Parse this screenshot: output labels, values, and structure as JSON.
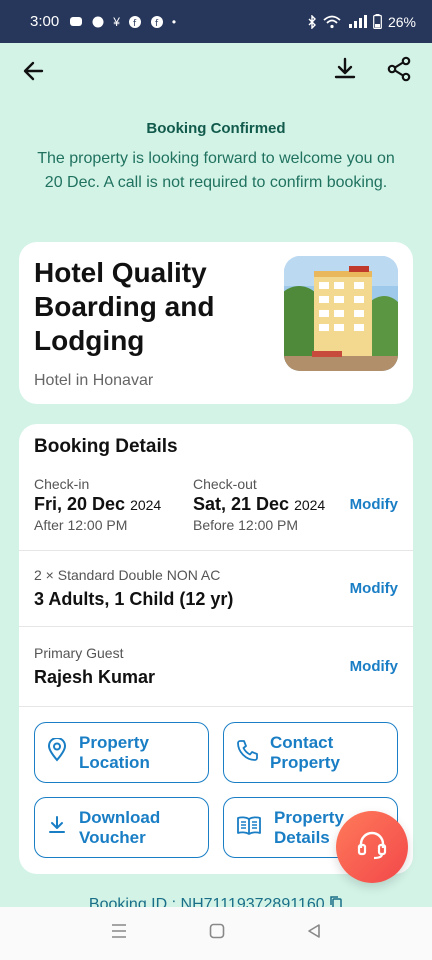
{
  "status_bar": {
    "time": "3:00",
    "battery": "26%"
  },
  "app_bar": {
    "back_icon": "back-arrow-icon",
    "download_icon": "download-icon",
    "share_icon": "share-icon"
  },
  "confirmation": {
    "title": "Booking Confirmed",
    "message": "The property is looking forward to welcome you on 20 Dec. A call is not required to confirm booking."
  },
  "hotel": {
    "name": "Hotel Quality Boarding and Lodging",
    "subtitle": "Hotel in Honavar"
  },
  "booking_details": {
    "heading": "Booking Details",
    "checkin": {
      "label": "Check-in",
      "date": "Fri, 20 Dec",
      "year": "2024",
      "time": "After  12:00 PM"
    },
    "checkout": {
      "label": "Check-out",
      "date": "Sat, 21 Dec",
      "year": "2024",
      "time": "Before  12:00 PM"
    },
    "dates_modify": "Modify",
    "room": {
      "type": "2 × Standard Double NON AC",
      "guests": "3 Adults, 1 Child (12 yr)",
      "modify": "Modify"
    },
    "guest": {
      "label": "Primary Guest",
      "name": "Rajesh  Kumar",
      "modify": "Modify"
    },
    "actions": [
      {
        "label_line1": "Property",
        "label_line2": "Location",
        "icon": "location-pin-icon"
      },
      {
        "label_line1": "Contact",
        "label_line2": "Property",
        "icon": "phone-icon"
      },
      {
        "label_line1": "Download",
        "label_line2": "Voucher",
        "icon": "download-icon"
      },
      {
        "label_line1": "Property",
        "label_line2": "Details",
        "icon": "book-icon"
      }
    ]
  },
  "booking_id": "Booking ID : NH71119372891160",
  "colors": {
    "background": "#d3f3e7",
    "accent": "#1a7ec5",
    "confirm_text": "#125b4c",
    "status_bar": "#27375b"
  }
}
